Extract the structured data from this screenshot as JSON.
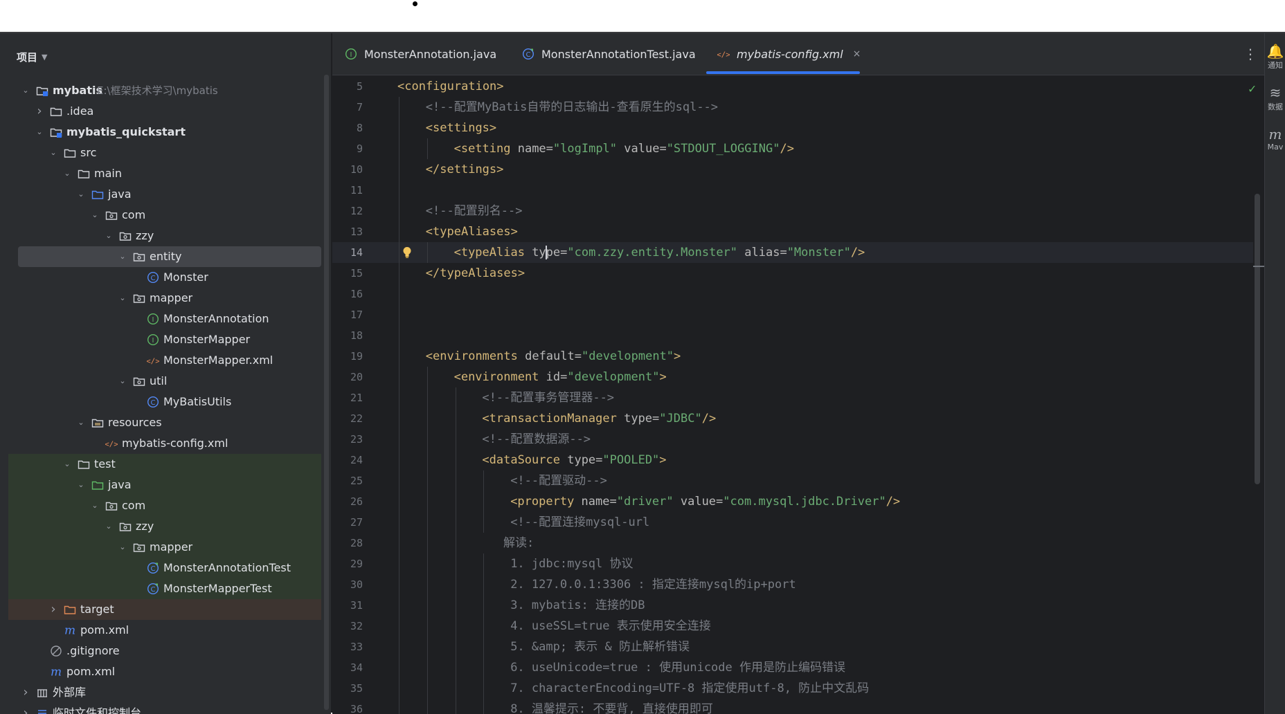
{
  "project": {
    "title": "项目",
    "tree": [
      {
        "label": "mybatis",
        "hint": "E:\\框架技术学习\\mybatis",
        "depth": 0,
        "arrow": "down",
        "icon": "module-folder",
        "bold": true
      },
      {
        "label": ".idea",
        "depth": 1,
        "arrow": "right",
        "icon": "folder"
      },
      {
        "label": "mybatis_quickstart",
        "depth": 1,
        "arrow": "down",
        "icon": "module-folder",
        "bold": true
      },
      {
        "label": "src",
        "depth": 2,
        "arrow": "down",
        "icon": "folder"
      },
      {
        "label": "main",
        "depth": 3,
        "arrow": "down",
        "icon": "folder"
      },
      {
        "label": "java",
        "depth": 4,
        "arrow": "down",
        "icon": "source-folder"
      },
      {
        "label": "com",
        "depth": 5,
        "arrow": "down",
        "icon": "package"
      },
      {
        "label": "zzy",
        "depth": 6,
        "arrow": "down",
        "icon": "package"
      },
      {
        "label": "entity",
        "depth": 7,
        "arrow": "down",
        "icon": "package",
        "selected": true
      },
      {
        "label": "Monster",
        "depth": 8,
        "icon": "class"
      },
      {
        "label": "mapper",
        "depth": 7,
        "arrow": "down",
        "icon": "package"
      },
      {
        "label": "MonsterAnnotation",
        "depth": 8,
        "icon": "interface"
      },
      {
        "label": "MonsterMapper",
        "depth": 8,
        "icon": "interface"
      },
      {
        "label": "MonsterMapper.xml",
        "depth": 8,
        "icon": "xml"
      },
      {
        "label": "util",
        "depth": 7,
        "arrow": "down",
        "icon": "package"
      },
      {
        "label": "MyBatisUtils",
        "depth": 8,
        "icon": "class"
      },
      {
        "label": "resources",
        "depth": 4,
        "arrow": "down",
        "icon": "resources-folder"
      },
      {
        "label": "mybatis-config.xml",
        "depth": 5,
        "icon": "xml"
      },
      {
        "label": "test",
        "depth": 3,
        "arrow": "down",
        "icon": "folder",
        "bg": "test"
      },
      {
        "label": "java",
        "depth": 4,
        "arrow": "down",
        "icon": "test-folder",
        "bg": "test"
      },
      {
        "label": "com",
        "depth": 5,
        "arrow": "down",
        "icon": "package",
        "bg": "test"
      },
      {
        "label": "zzy",
        "depth": 6,
        "arrow": "down",
        "icon": "package",
        "bg": "test"
      },
      {
        "label": "mapper",
        "depth": 7,
        "arrow": "down",
        "icon": "package",
        "bg": "test"
      },
      {
        "label": "MonsterAnnotationTest",
        "depth": 8,
        "icon": "test-class",
        "bg": "test"
      },
      {
        "label": "MonsterMapperTest",
        "depth": 8,
        "icon": "test-class",
        "bg": "test"
      },
      {
        "label": "target",
        "depth": 2,
        "arrow": "right",
        "icon": "excluded-folder",
        "bg": "excluded"
      },
      {
        "label": "pom.xml",
        "depth": 2,
        "icon": "maven"
      },
      {
        "label": ".gitignore",
        "depth": 1,
        "icon": "ignore"
      },
      {
        "label": "pom.xml",
        "depth": 1,
        "icon": "maven"
      },
      {
        "label": "外部库",
        "depth": 0,
        "arrow": "right",
        "icon": "library"
      },
      {
        "label": "临时文件和控制台",
        "depth": 0,
        "arrow": "right",
        "icon": "scratch"
      }
    ]
  },
  "tabs": [
    {
      "label": "MonsterAnnotation.java",
      "icon": "interface",
      "active": false
    },
    {
      "label": "MonsterAnnotationTest.java",
      "icon": "test-class",
      "active": false
    },
    {
      "label": "mybatis-config.xml",
      "icon": "xml",
      "active": true,
      "close": "×"
    }
  ],
  "editor": {
    "more_glyph": "⋮",
    "check_glyph": "✓",
    "current_line": 14,
    "lines": [
      {
        "n": "5",
        "indent": 0,
        "parts": [
          [
            "t",
            "<configuration>"
          ]
        ]
      },
      {
        "n": "7",
        "indent": 1,
        "parts": [
          [
            "c",
            "<!--配置MyBatis自带的日志输出-查看原生的sql-->"
          ]
        ]
      },
      {
        "n": "8",
        "indent": 1,
        "parts": [
          [
            "t",
            "<settings>"
          ]
        ]
      },
      {
        "n": "9",
        "indent": 2,
        "parts": [
          [
            "t",
            "<setting "
          ],
          [
            "a",
            "name="
          ],
          [
            "v",
            "\"logImpl\""
          ],
          [
            "a",
            " value="
          ],
          [
            "v",
            "\"STDOUT_LOGGING\""
          ],
          [
            "t",
            "/>"
          ]
        ]
      },
      {
        "n": "10",
        "indent": 1,
        "parts": [
          [
            "t",
            "</settings>"
          ]
        ]
      },
      {
        "n": "11",
        "indent": 1,
        "parts": []
      },
      {
        "n": "12",
        "indent": 1,
        "parts": [
          [
            "c",
            "<!--配置别名-->"
          ]
        ]
      },
      {
        "n": "13",
        "indent": 1,
        "parts": [
          [
            "t",
            "<typeAliases>"
          ]
        ]
      },
      {
        "n": "14",
        "indent": 2,
        "parts": [
          [
            "t",
            "<typeAlias "
          ],
          [
            "a",
            "ty"
          ],
          [
            "caret",
            ""
          ],
          [
            "a",
            "pe="
          ],
          [
            "v",
            "\"com.zzy.entity.Monster\""
          ],
          [
            "a",
            " alias="
          ],
          [
            "v",
            "\"Monster\""
          ],
          [
            "t",
            "/>"
          ]
        ]
      },
      {
        "n": "15",
        "indent": 1,
        "parts": [
          [
            "t",
            "</typeAliases>"
          ]
        ]
      },
      {
        "n": "16",
        "indent": 1,
        "parts": []
      },
      {
        "n": "17",
        "indent": 1,
        "parts": []
      },
      {
        "n": "18",
        "indent": 1,
        "parts": []
      },
      {
        "n": "19",
        "indent": 1,
        "parts": [
          [
            "t",
            "<environments "
          ],
          [
            "a",
            "default="
          ],
          [
            "v",
            "\"development\""
          ],
          [
            "t",
            ">"
          ]
        ]
      },
      {
        "n": "20",
        "indent": 2,
        "parts": [
          [
            "t",
            "<environment "
          ],
          [
            "a",
            "id="
          ],
          [
            "v",
            "\"development\""
          ],
          [
            "t",
            ">"
          ]
        ]
      },
      {
        "n": "21",
        "indent": 3,
        "parts": [
          [
            "c",
            "<!--配置事务管理器-->"
          ]
        ]
      },
      {
        "n": "22",
        "indent": 3,
        "parts": [
          [
            "t",
            "<transactionManager "
          ],
          [
            "a",
            "type="
          ],
          [
            "v",
            "\"JDBC\""
          ],
          [
            "t",
            "/>"
          ]
        ]
      },
      {
        "n": "23",
        "indent": 3,
        "parts": [
          [
            "c",
            "<!--配置数据源-->"
          ]
        ]
      },
      {
        "n": "24",
        "indent": 3,
        "parts": [
          [
            "t",
            "<dataSource "
          ],
          [
            "a",
            "type="
          ],
          [
            "v",
            "\"POOLED\""
          ],
          [
            "t",
            ">"
          ]
        ]
      },
      {
        "n": "25",
        "indent": 4,
        "parts": [
          [
            "c",
            "<!--配置驱动-->"
          ]
        ]
      },
      {
        "n": "26",
        "indent": 4,
        "parts": [
          [
            "t",
            "<property "
          ],
          [
            "a",
            "name="
          ],
          [
            "v",
            "\"driver\""
          ],
          [
            "a",
            " value="
          ],
          [
            "v",
            "\"com.mysql.jdbc.Driver\""
          ],
          [
            "t",
            "/>"
          ]
        ]
      },
      {
        "n": "27",
        "indent": 4,
        "parts": [
          [
            "c",
            "<!--配置连接mysql-url"
          ]
        ]
      },
      {
        "n": "28",
        "indent": 3.75,
        "parts": [
          [
            "c",
            "解读:"
          ]
        ]
      },
      {
        "n": "29",
        "indent": 4,
        "parts": [
          [
            "c",
            "1. jdbc:mysql 协议"
          ]
        ]
      },
      {
        "n": "30",
        "indent": 4,
        "parts": [
          [
            "c",
            "2. 127.0.0.1:3306 : 指定连接mysql的ip+port"
          ]
        ]
      },
      {
        "n": "31",
        "indent": 4,
        "parts": [
          [
            "c",
            "3. mybatis: 连接的DB"
          ]
        ]
      },
      {
        "n": "32",
        "indent": 4,
        "parts": [
          [
            "c",
            "4. useSSL=true 表示使用安全连接"
          ]
        ]
      },
      {
        "n": "33",
        "indent": 4,
        "parts": [
          [
            "c",
            "5. &amp; 表示 & 防止解析错误"
          ]
        ]
      },
      {
        "n": "34",
        "indent": 4,
        "parts": [
          [
            "c",
            "6. useUnicode=true : 使用unicode 作用是防止编码错误"
          ]
        ]
      },
      {
        "n": "35",
        "indent": 4,
        "parts": [
          [
            "c",
            "7. characterEncoding=UTF-8 指定使用utf-8, 防止中文乱码"
          ]
        ]
      },
      {
        "n": "36",
        "indent": 4,
        "parts": [
          [
            "c",
            "8. 温馨提示: 不要背, 直接使用即可"
          ]
        ]
      }
    ]
  },
  "rightbar": [
    {
      "glyph": "🔔",
      "label": "通知",
      "name": "notifications-icon"
    },
    {
      "glyph": "≋",
      "label": "数据",
      "name": "database-icon"
    },
    {
      "glyph": "m",
      "label": "Mav",
      "name": "maven-icon"
    }
  ]
}
